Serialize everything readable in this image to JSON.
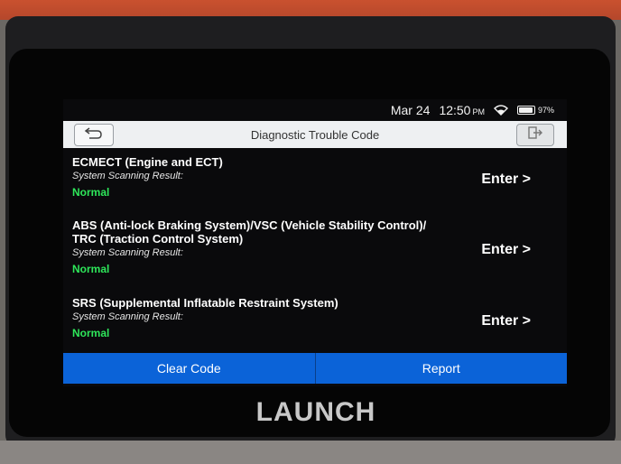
{
  "status_bar": {
    "date": "Mar 24",
    "time": "12:50",
    "time_suffix": "PM",
    "battery_percent": "97%",
    "battery_level": 0.97,
    "icons": [
      "wifi-icon",
      "battery-icon"
    ]
  },
  "header": {
    "title": "Diagnostic Trouble Code",
    "back_icon": "back-arrow-icon",
    "exit_icon": "exit-icon"
  },
  "systems": [
    {
      "name": "ECMECT (Engine and ECT)",
      "scan_label": "System Scanning Result:",
      "result": "Normal",
      "action": "Enter >"
    },
    {
      "name": "ABS (Anti-lock Braking System)/VSC (Vehicle Stability Control)/",
      "name_line2": "TRC (Traction Control System)",
      "scan_label": "System Scanning Result:",
      "result": "Normal",
      "action": "Enter >"
    },
    {
      "name": "SRS (Supplemental Inflatable Restraint System)",
      "scan_label": "System Scanning Result:",
      "result": "Normal",
      "action": "Enter >"
    }
  ],
  "footer": {
    "clear_label": "Clear Code",
    "report_label": "Report"
  },
  "device": {
    "brand": "LAUNCH"
  },
  "colors": {
    "accent_blue": "#0b63d8",
    "normal_green": "#2ee65a",
    "header_bg": "#eef0f2"
  }
}
